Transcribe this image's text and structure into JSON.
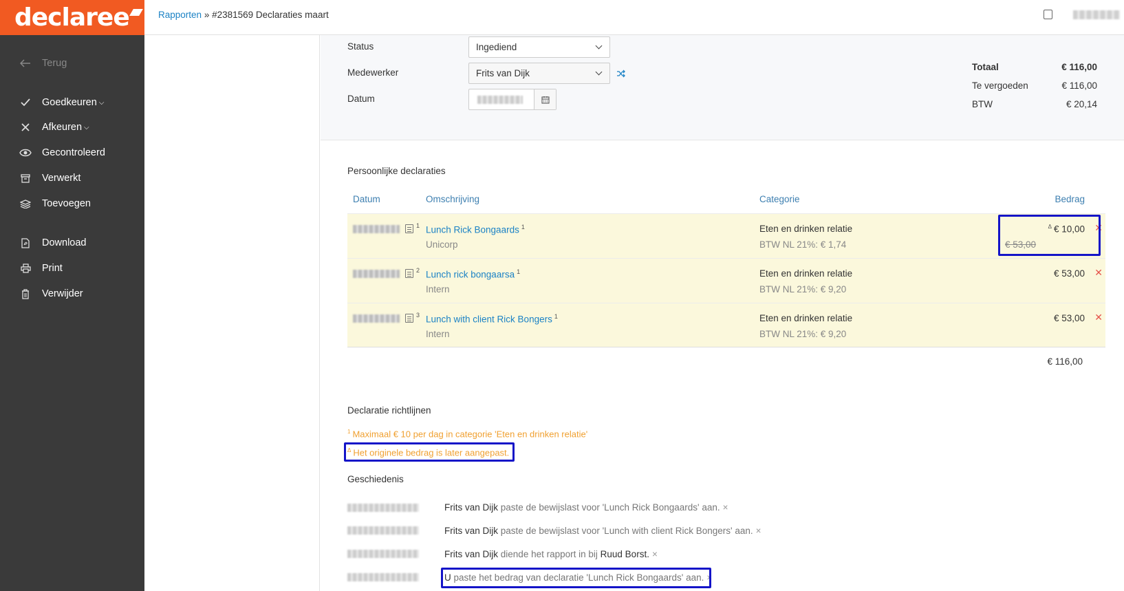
{
  "app": {
    "logo": "declaree"
  },
  "sidebar": {
    "back": "Terug",
    "items": [
      {
        "label": "Goedkeuren",
        "icon": "check-icon"
      },
      {
        "label": "Afkeuren",
        "icon": "x-icon"
      },
      {
        "label": "Gecontroleerd",
        "icon": "eye-icon"
      },
      {
        "label": "Verwerkt",
        "icon": "archive-icon"
      },
      {
        "label": "Toevoegen",
        "icon": "stack-icon"
      },
      {
        "label": "Download",
        "icon": "pdf-icon"
      },
      {
        "label": "Print",
        "icon": "printer-icon"
      },
      {
        "label": "Verwijder",
        "icon": "trash-icon"
      }
    ]
  },
  "breadcrumb": {
    "link": "Rapporten",
    "sep": "»",
    "current": "#2381569 Declaraties maart"
  },
  "form": {
    "status_label": "Status",
    "status_value": "Ingediend",
    "employee_label": "Medewerker",
    "employee_value": "Frits van Dijk",
    "date_label": "Datum"
  },
  "totals": {
    "total_label": "Totaal",
    "total_value": "€ 116,00",
    "refund_label": "Te vergoeden",
    "refund_value": "€ 116,00",
    "vat_label": "BTW",
    "vat_value": "€ 20,14"
  },
  "expenses": {
    "title": "Persoonlijke declaraties",
    "columns": {
      "date": "Datum",
      "description": "Omschrijving",
      "category": "Categorie",
      "amount": "Bedrag"
    },
    "rows": [
      {
        "num": "1",
        "description": "Lunch Rick Bongaards",
        "ref": "1",
        "sub": "Unicorp",
        "category": "Eten en drinken relatie",
        "vat": "BTW NL 21%: € 1,74",
        "amount": "€ 10,00",
        "changed_mark": "Δ",
        "original": "€ 53,00"
      },
      {
        "num": "2",
        "description": "Lunch rick bongaarsa",
        "ref": "1",
        "sub": "Intern",
        "category": "Eten en drinken relatie",
        "vat": "BTW NL 21%: € 9,20",
        "amount": "€ 53,00"
      },
      {
        "num": "3",
        "description": "Lunch with client Rick Bongers",
        "ref": "1",
        "sub": "Intern",
        "category": "Eten en drinken relatie",
        "vat": "BTW NL 21%: € 9,20",
        "amount": "€ 53,00"
      }
    ],
    "total": "€ 116,00"
  },
  "guidelines": {
    "title": "Declaratie richtlijnen",
    "items": [
      {
        "mark": "1",
        "text": "Maximaal € 10 per dag in categorie 'Eten en drinken relatie'"
      },
      {
        "mark": "Δ",
        "text": "Het originele bedrag is later aangepast."
      }
    ]
  },
  "history": {
    "title": "Geschiedenis",
    "items": [
      {
        "who": "Frits van Dijk",
        "text": "paste de bewijslast voor 'Lunch Rick Bongaards' aan."
      },
      {
        "who": "Frits van Dijk",
        "text": "paste de bewijslast voor 'Lunch with client Rick Bongers' aan."
      },
      {
        "who": "Frits van Dijk",
        "text": "diende het rapport in bij",
        "target": "Ruud Borst."
      },
      {
        "who": "U",
        "text": "paste het bedrag van declaratie 'Lunch Rick Bongaards' aan."
      }
    ],
    "close": "×"
  },
  "colors": {
    "brand": "#f15a22",
    "sidebar": "#3a3a3a",
    "link": "#1b82c5",
    "row_bg": "#fbf8dc",
    "guideline": "#f0a030",
    "highlight": "#1414c8"
  }
}
